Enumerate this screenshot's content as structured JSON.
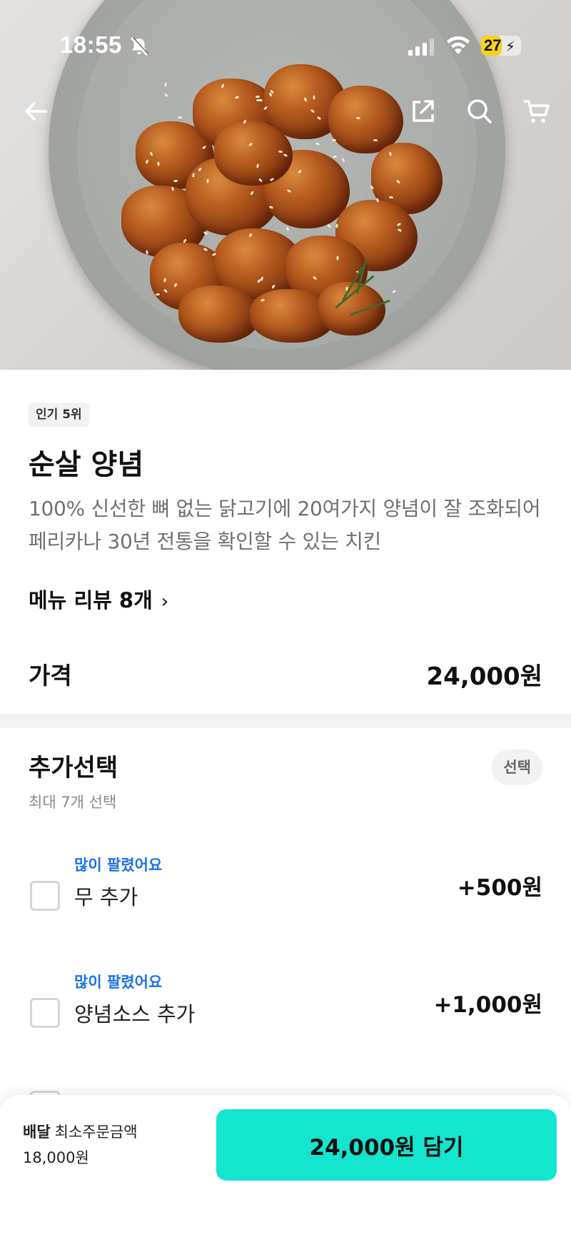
{
  "status_bar": {
    "time": "18:55",
    "battery_percent": "27",
    "battery_level": 0.27,
    "icons": [
      "bell-slash-icon",
      "signal-icon",
      "wifi-icon",
      "battery-charging-icon"
    ]
  },
  "header": {
    "back_icon": "arrow-left-icon",
    "share_icon": "share-icon",
    "search_icon": "search-icon",
    "cart_icon": "cart-icon"
  },
  "menu": {
    "badge": "인기 5위",
    "name": "순살 양념",
    "description": "100% 신선한 뼈 없는 닭고기에 20여가지 양념이 잘 조화되어 페리카나 30년 전통을 확인할 수 있는 치킨",
    "review_link": "메뉴 리뷰 8개",
    "price_label": "가격",
    "price": "24,000원"
  },
  "options": {
    "title": "추가선택",
    "subtitle": "최대 7개 선택",
    "pill": "선택",
    "items": [
      {
        "tag": "많이 팔렸어요",
        "name": "무 추가",
        "price": "+500원",
        "checked": false
      },
      {
        "tag": "많이 팔렸어요",
        "name": "양념소스 추가",
        "price": "+1,000원",
        "checked": false
      }
    ]
  },
  "bottom_bar": {
    "delivery_label": "배달",
    "min_order_label": "최소주문금액",
    "min_order_value": "18,000원",
    "cta_label": "24,000원 담기"
  },
  "colors": {
    "accent": "#13e5cf",
    "tag_blue": "#1a73e8",
    "battery_yellow": "#f5d416"
  }
}
